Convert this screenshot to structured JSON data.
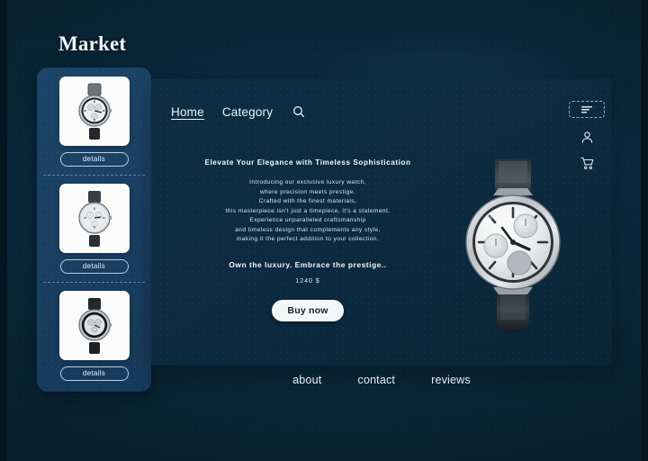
{
  "brand": {
    "title": "Market"
  },
  "nav": {
    "links": [
      {
        "label": "Home",
        "active": true
      },
      {
        "label": "Category",
        "active": false
      }
    ],
    "search_icon": "search-icon"
  },
  "rail": {
    "menu_icon": "menu-list-icon",
    "account_icon": "user-icon",
    "cart_icon": "shopping-cart-icon"
  },
  "hero": {
    "headline": "Elevate Your Elegance with Timeless Sophistication",
    "body_lines": [
      "Introducing our exclusive luxury watch,",
      "where precision meets prestige.",
      "Crafted with the finest materials,",
      "this masterpiece isn't just a timepiece, it's a statement.",
      "Experience unparalleled craftsmanship",
      "and timeless design that complements any style,",
      "making it the perfect addition to your collection."
    ],
    "tagline": "Own the luxury. Embrace the prestige..",
    "price": "1240 $",
    "buy_label": "Buy now",
    "product_image": "luxury-chronograph-watch"
  },
  "sidebar": {
    "products": [
      {
        "image": "watch-thumbnail-1",
        "details_label": "details"
      },
      {
        "image": "watch-thumbnail-2",
        "details_label": "details"
      },
      {
        "image": "watch-thumbnail-3",
        "details_label": "details"
      }
    ]
  },
  "footer": {
    "links": [
      {
        "label": "about"
      },
      {
        "label": "contact"
      },
      {
        "label": "reviews"
      }
    ]
  },
  "colors": {
    "page_background": "#0b2c43",
    "sidebar": "#1a4062",
    "panel": "#0c2b41",
    "text": "#e8f0f6",
    "button_background": "#f4f7f9",
    "button_text": "#16202a"
  }
}
